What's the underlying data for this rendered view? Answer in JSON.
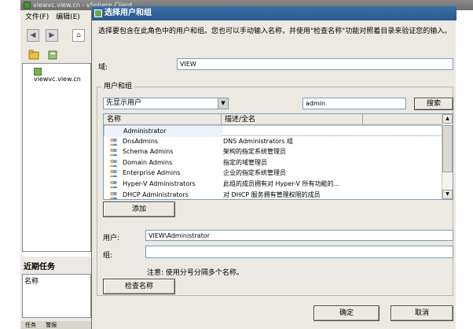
{
  "bg_window": {
    "title": "viewvc.view.cn - vSphere Client",
    "menu": [
      "文件(F)",
      "编辑(E)"
    ],
    "tree_item": "viewvc.view.cn",
    "recent_tasks_title": "近期任务",
    "recent_tasks_column": "名称",
    "bottom_tabs": [
      "任务",
      "警报"
    ]
  },
  "dialog": {
    "title": "选择用户和组",
    "description": "选择要包含在此角色中的用户和组。您也可以手动输入名称，并使用\"检查名称\"功能对照着目录来验证您的输入。",
    "domain_label": "域:",
    "domain_value": "VIEW",
    "group_legend": "用户和组",
    "filter_select": "先显示用户",
    "search_value": "admin",
    "search_button": "搜索",
    "columns": [
      "名称",
      "描述/全名"
    ],
    "rows": [
      {
        "name": "Administrator",
        "desc": "",
        "icon": "user-icon",
        "selected": true
      },
      {
        "name": "DnsAdmins",
        "desc": "DNS Administrators 组",
        "icon": "group-icon"
      },
      {
        "name": "Schema Admins",
        "desc": "架构的指定系统管理员",
        "icon": "group-icon"
      },
      {
        "name": "Domain Admins",
        "desc": "指定的域管理员",
        "icon": "group-icon"
      },
      {
        "name": "Enterprise Admins",
        "desc": "企业的指定系统管理员",
        "icon": "group-icon"
      },
      {
        "name": "Hyper-V Administrators",
        "desc": "此组的成员拥有对 Hyper-V 所有功能的...",
        "icon": "group-icon"
      },
      {
        "name": "DHCP Administrators",
        "desc": "对 DHCP 服务拥有管理权限的成员",
        "icon": "group-icon"
      }
    ],
    "add_button": "添加",
    "user_label": "用户:",
    "user_value": "VIEW\\Administrator",
    "group_label": "组:",
    "group_value": "",
    "note": "注意: 使用分号分隔多个名称。",
    "check_names_button": "检查名称",
    "ok_button": "确定",
    "cancel_button": "取消"
  },
  "colors": {
    "title_bar": "#2a5a90",
    "window_bg": "#ece9e2",
    "field_border": "#7f9db9"
  }
}
